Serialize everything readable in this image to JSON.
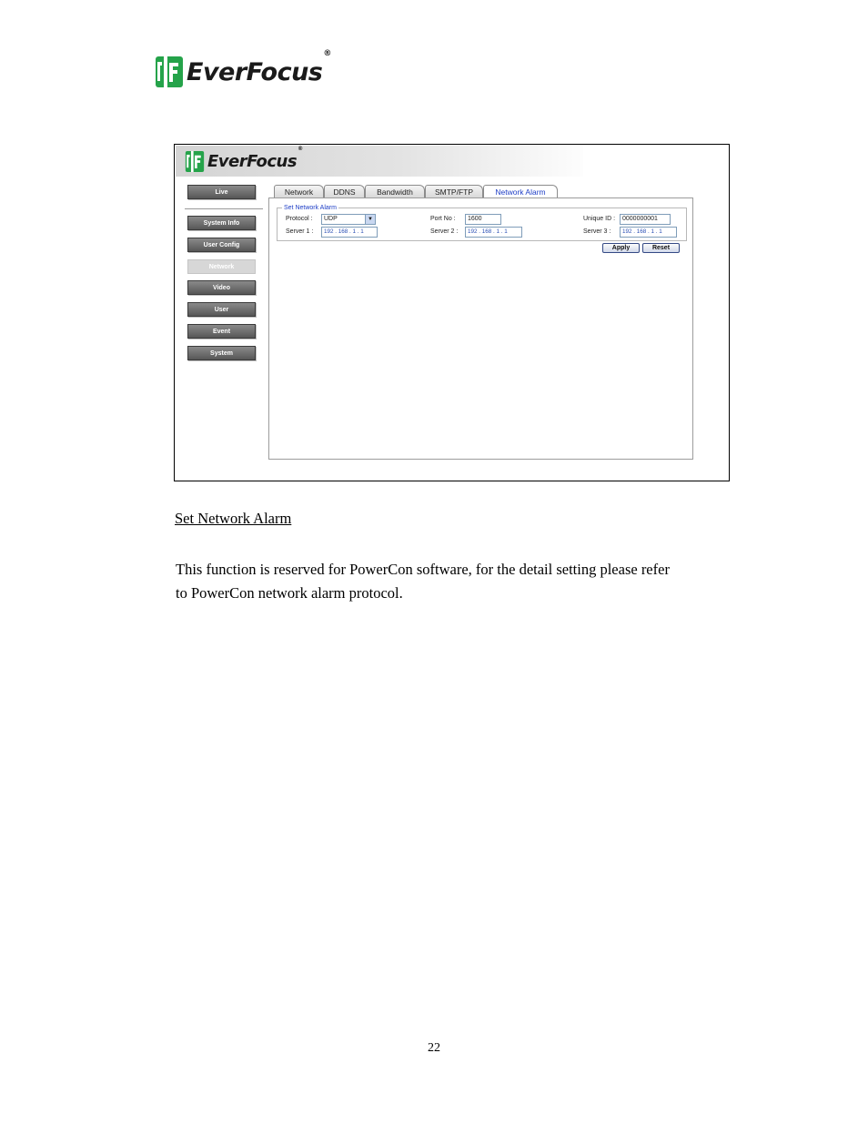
{
  "logo": {
    "brand": "EverFocus",
    "registered": "®"
  },
  "screenshot": {
    "logo": {
      "brand": "EverFocus",
      "registered": "®"
    },
    "sidebar": {
      "live": "Live",
      "items": [
        "System Info",
        "User Config",
        "Network",
        "Video",
        "User",
        "Event",
        "System"
      ],
      "active": "Network"
    },
    "tabs": [
      "Network",
      "DDNS",
      "Bandwidth",
      "SMTP/FTP",
      "Network Alarm"
    ],
    "active_tab": "Network Alarm",
    "group_title": "Set Network Alarm",
    "protocol": {
      "label": "Protocol :",
      "value": "UDP"
    },
    "port": {
      "label": "Port No :",
      "value": "1600"
    },
    "unique_id": {
      "label": "Unique ID :",
      "value": "0000000001"
    },
    "server1": {
      "label": "Server 1 :",
      "value": "192 . 168 .   1   .   1"
    },
    "server2": {
      "label": "Server 2 :",
      "value": "192 . 168 .   1   .   1"
    },
    "server3": {
      "label": "Server 3 :",
      "value": "192 . 168 .   1   .   1"
    },
    "apply": "Apply",
    "reset": "Reset",
    "colors": {
      "link_blue": "#1e3ec6",
      "button_gray": "#6e6e6e"
    }
  },
  "section_title": "Set Network Alarm",
  "paragraph_line1": "This function is reserved for PowerCon software, for the detail setting please refer",
  "paragraph_line2": "to PowerCon network alarm protocol.",
  "page_number": "22"
}
